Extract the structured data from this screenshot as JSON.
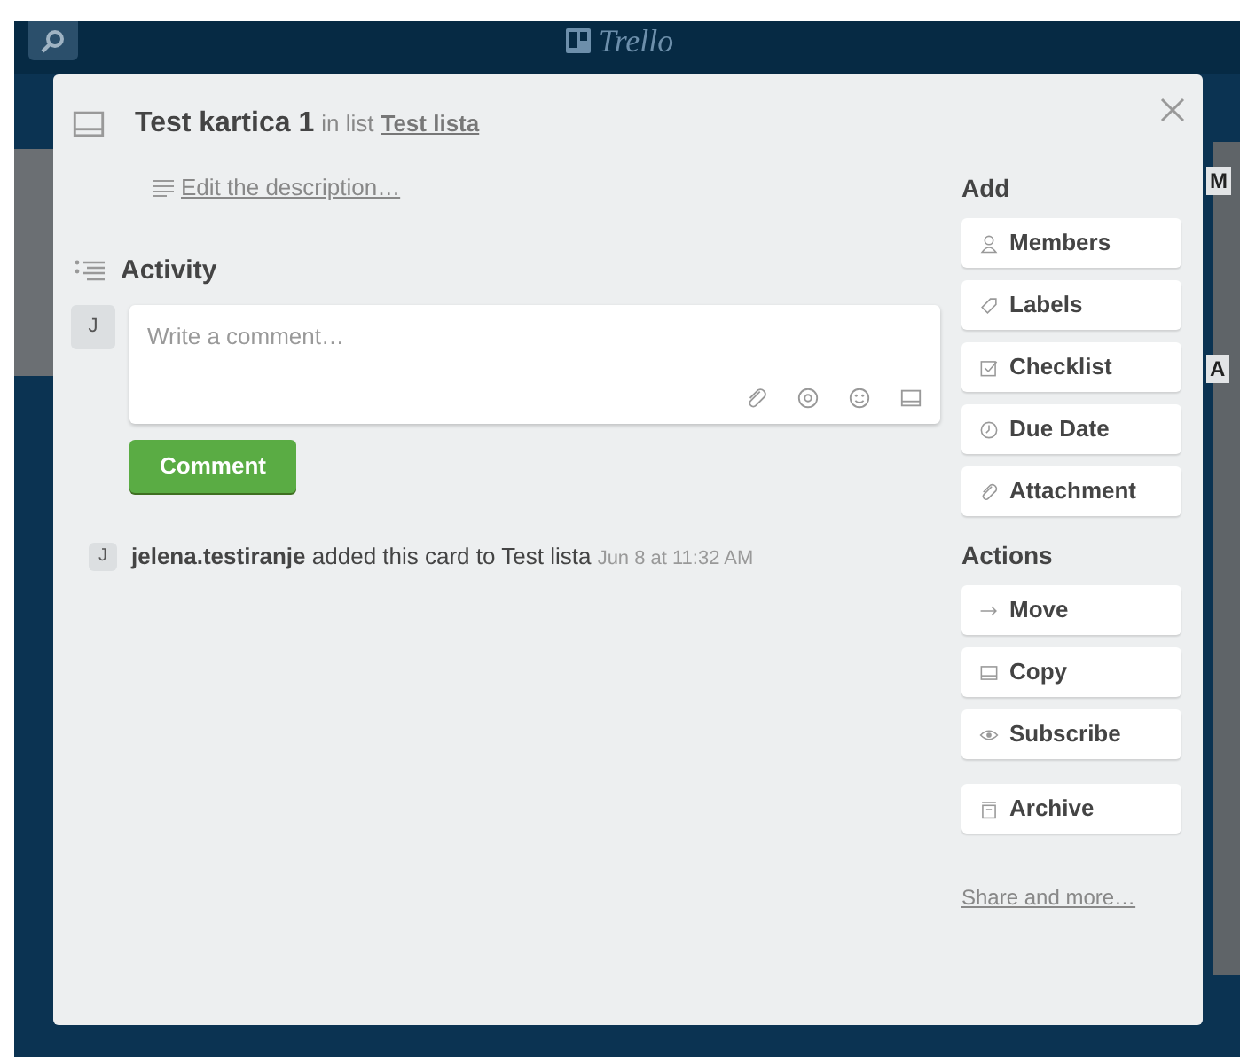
{
  "header": {
    "logo_text": "Trello"
  },
  "board_fragments": [
    "M",
    "A"
  ],
  "card": {
    "title": "Test kartica 1",
    "list_prefix": "in list",
    "list_name": "Test lista",
    "description_link": "Edit the description…",
    "activity_heading": "Activity",
    "comment": {
      "avatar": "J",
      "placeholder": "Write a comment…",
      "button": "Comment"
    },
    "activity": [
      {
        "avatar": "J",
        "user": "jelena.testiranje",
        "text": "added this card to Test lista",
        "time": "Jun 8 at 11:32 AM"
      }
    ]
  },
  "sidebar": {
    "sections": [
      {
        "heading": "Add",
        "buttons": [
          {
            "label": "Members",
            "kind": "person"
          },
          {
            "label": "Labels",
            "kind": "tag"
          },
          {
            "label": "Checklist",
            "kind": "checkbox"
          },
          {
            "label": "Due Date",
            "kind": "clock"
          },
          {
            "label": "Attachment",
            "kind": "paperclip"
          }
        ]
      },
      {
        "heading": "Actions",
        "buttons": [
          {
            "label": "Move",
            "kind": "arrow"
          },
          {
            "label": "Copy",
            "kind": "card"
          },
          {
            "label": "Subscribe",
            "kind": "eye"
          }
        ],
        "more_buttons": [
          {
            "label": "Archive",
            "kind": "archive"
          }
        ]
      }
    ],
    "share_link": "Share and more…"
  }
}
